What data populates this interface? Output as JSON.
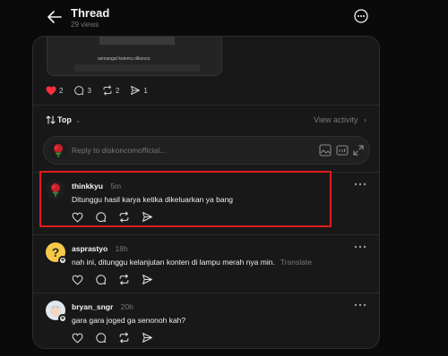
{
  "header": {
    "title": "Thread",
    "views": "29 views"
  },
  "post": {
    "media_caption": "semangat ketemu dikonco",
    "stats": {
      "likes": "2",
      "comments": "3",
      "reposts": "2",
      "shares": "1"
    }
  },
  "sort": {
    "label": "Top",
    "view_activity": "View activity"
  },
  "reply": {
    "placeholder": "Reply to diskoncomofficial..."
  },
  "comments": [
    {
      "username": "thinkkyu",
      "time": "5m",
      "text": "Ditunggu hasil karya ketika dikeluarkan ya bang"
    },
    {
      "username": "asprastyo",
      "time": "18h",
      "text": "nah ini, ditunggu kelanjutan konten di lampu merah nya min.",
      "translate": "Translate"
    },
    {
      "username": "bryan_sngr",
      "time": "20h",
      "text": "gara gara joged ga senonoh kah?"
    }
  ],
  "colors": {
    "like_red": "#ff3040",
    "highlight": "#e01b1b",
    "card_bg": "#181818"
  }
}
